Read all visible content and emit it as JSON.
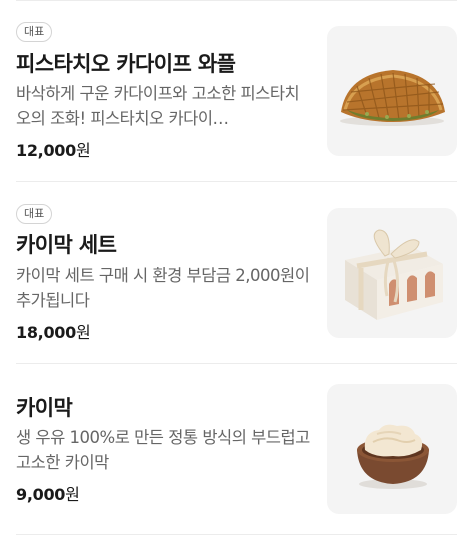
{
  "menu": {
    "items": [
      {
        "badge": "대표",
        "name": "피스타치오 카다이프 와플",
        "description": "바삭하게 구운 카다이프와 고소한 피스타치오의 조화! 피스타치오 카다이…",
        "price": "12,000",
        "currency": "원",
        "image_icon": "waffle-photo"
      },
      {
        "badge": "대표",
        "name": "카이막 세트",
        "description": "카이막 세트 구매 시 환경 부담금 2,000원이 추가됩니다",
        "price": "18,000",
        "currency": "원",
        "image_icon": "gift-box-photo"
      },
      {
        "name": "카이막",
        "description": "생 우유 100%로 만든 정통 방식의 부드럽고 고소한 카이막",
        "price": "9,000",
        "currency": "원",
        "image_icon": "kaymak-bowl-photo"
      }
    ]
  }
}
